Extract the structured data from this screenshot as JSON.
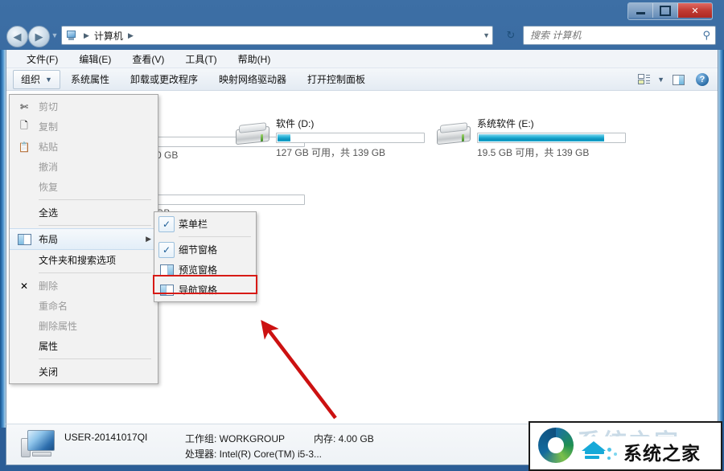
{
  "window": {
    "buttons": {
      "minimize": "minimize-button",
      "maximize": "maximize-button",
      "close": "✕"
    }
  },
  "address_bar": {
    "back": "◀",
    "forward": "▶",
    "history_caret": "▼",
    "crumb_root": "计算机",
    "crumb_sep": "▶",
    "crumb_dropdown": "▼",
    "refresh": "↻"
  },
  "search": {
    "placeholder": "搜索 计算机",
    "value": "",
    "icon": "search-icon"
  },
  "menubar": {
    "items": [
      {
        "label": "文件(F)"
      },
      {
        "label": "编辑(E)"
      },
      {
        "label": "查看(V)"
      },
      {
        "label": "工具(T)"
      },
      {
        "label": "帮助(H)"
      }
    ]
  },
  "toolbar": {
    "organize_label": "组织",
    "organize_caret": "▼",
    "buttons": [
      {
        "label": "系统属性"
      },
      {
        "label": "卸载或更改程序"
      },
      {
        "label": "映射网络驱动器"
      },
      {
        "label": "打开控制面板"
      }
    ],
    "right_icons": [
      {
        "name": "view-options-icon",
        "caret": "▼"
      },
      {
        "name": "preview-pane-icon"
      },
      {
        "name": "help-icon",
        "glyph": "?"
      }
    ]
  },
  "drives": [
    {
      "name": "软件 (D:)",
      "info": "127 GB 可用，共 139 GB",
      "fill_percent": 9,
      "partial": false
    },
    {
      "name": "系统软件 (E:)",
      "info": "19.5 GB 可用，共 139 GB",
      "fill_percent": 86,
      "partial": false
    }
  ],
  "hidden_drives": [
    {
      "info_tail": "0 GB"
    },
    {
      "info_tail": "GB"
    }
  ],
  "context_menu": {
    "items": [
      {
        "label": "剪切",
        "icon": "scissors-icon",
        "disabled": true
      },
      {
        "label": "复制",
        "icon": "copy-icon",
        "disabled": true
      },
      {
        "label": "粘贴",
        "icon": "paste-icon",
        "disabled": true
      },
      {
        "label": "撤消",
        "icon": "",
        "disabled": true
      },
      {
        "label": "恢复",
        "icon": "",
        "disabled": true
      },
      {
        "label": "全选",
        "icon": "",
        "disabled": false
      },
      {
        "label": "布局",
        "icon": "layout-icon",
        "disabled": false,
        "submenu_arrow": "▶",
        "highlighted": true
      },
      {
        "label": "文件夹和搜索选项",
        "icon": "",
        "disabled": false
      },
      {
        "label": "删除",
        "icon": "delete-icon",
        "disabled": true
      },
      {
        "label": "重命名",
        "icon": "",
        "disabled": true
      },
      {
        "label": "删除属性",
        "icon": "",
        "disabled": true
      },
      {
        "label": "属性",
        "icon": "",
        "disabled": false
      },
      {
        "label": "关闭",
        "icon": "",
        "disabled": false
      }
    ]
  },
  "submenu": {
    "items": [
      {
        "label": "菜单栏",
        "checked": true,
        "icon": "checkmark-icon",
        "glyph": "✓"
      },
      {
        "label": "细节窗格",
        "checked": true,
        "icon": "checkmark-icon",
        "glyph": "✓"
      },
      {
        "label": "预览窗格",
        "checked": false,
        "icon": "preview-pane-icon"
      },
      {
        "label": "导航窗格",
        "checked": false,
        "icon": "navigation-pane-icon",
        "highlighted": true
      }
    ],
    "highlight_color": "#d71a16"
  },
  "annotation": {
    "arrow_color": "#cc1111"
  },
  "status_bar": {
    "computer_name": "USER-20141017QI",
    "workgroup": "工作组: WORKGROUP",
    "memory": "内存: 4.00 GB",
    "processor": "处理器: Intel(R) Core(TM) i5-3..."
  },
  "watermark": {
    "ghost_text": "系统之家",
    "text": "系统之家"
  }
}
